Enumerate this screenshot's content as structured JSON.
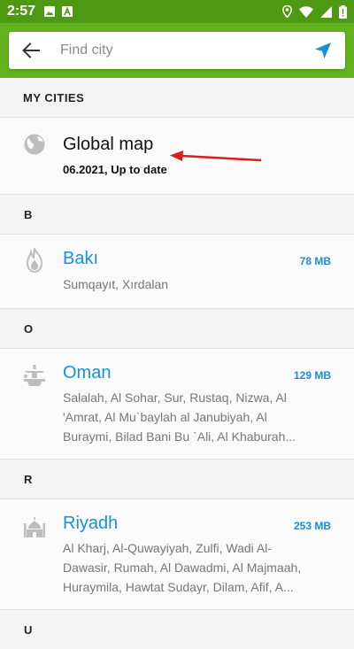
{
  "status_bar": {
    "time": "2:57"
  },
  "search": {
    "placeholder": "Find city"
  },
  "my_cities_header": "MY CITIES",
  "global_map": {
    "title": "Global map",
    "subtitle": "06.2021, Up to date"
  },
  "groups": [
    {
      "letter": "B",
      "city": "Bakı",
      "size": "78 MB",
      "subtitle": "Sumqayıt, Xırdalan"
    },
    {
      "letter": "O",
      "city": "Oman",
      "size": "129 MB",
      "subtitle_lines": [
        "Salalah, Al Sohar, Sur, Rustaq, Nizwa, Al",
        "'Amrat, Al Mu`baylah al Janubiyah, Al",
        "Buraymi, Bilad Bani Bu `Ali, Al Khaburah..."
      ]
    },
    {
      "letter": "R",
      "city": "Riyadh",
      "size": "253 MB",
      "subtitle_lines": [
        "Al Kharj, Al-Quwayiyah, Zulfi, Wadi Al-",
        "Dawasir, Rumah, Al Dawadmi, Al Majmaah,",
        "Huraymila, Hawtat Sudayr, Dilam, Afif, A..."
      ]
    },
    {
      "letter": "U"
    }
  ],
  "colors": {
    "status_bar": "#4d9a12",
    "header": "#64b21f",
    "accent": "#1a8fd6",
    "annotation_arrow": "#e01b1b"
  }
}
